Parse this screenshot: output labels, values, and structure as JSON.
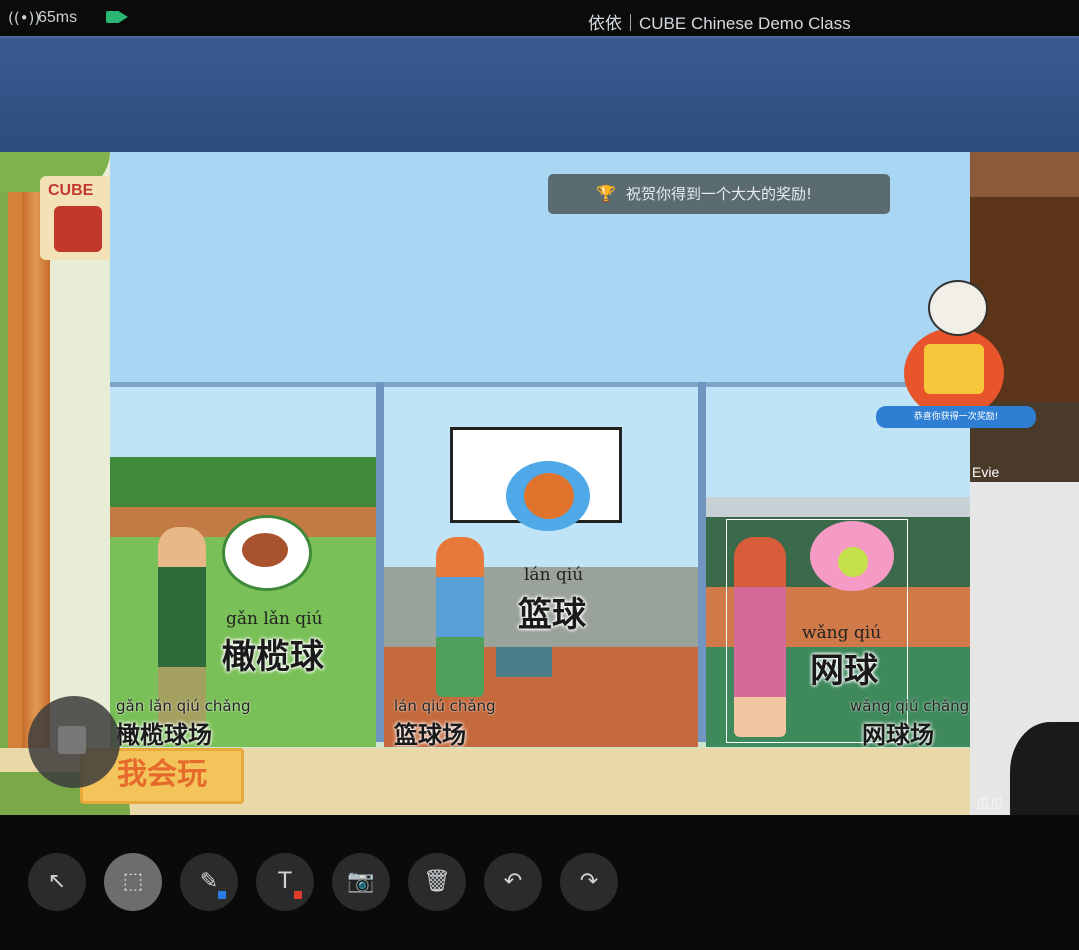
{
  "status": {
    "latency": "65ms",
    "window_title": "依依｜CUBE Chinese Demo Class"
  },
  "notice": {
    "text": "祝贺你得到一个大大的奖励!"
  },
  "logo": {
    "text": "CUBE"
  },
  "slide": {
    "football": {
      "pinyin": "gǎn lǎn qiú",
      "hanzi": "橄榄球",
      "field_pinyin": "gǎn lǎn qiú chǎng",
      "field_hanzi": "橄榄球场"
    },
    "basketball": {
      "pinyin": "lán qiú",
      "hanzi": "篮球",
      "field_pinyin": "lán qiú chǎng",
      "field_hanzi": "篮球场"
    },
    "tennis": {
      "pinyin": "wǎng qiú",
      "hanzi": "网球",
      "field_pinyin": "wǎng qiú chǎng",
      "field_hanzi": "网球场"
    },
    "sign": "我会玩"
  },
  "participants": [
    {
      "name": "Evie"
    },
    {
      "name": "瓜瓜"
    }
  ],
  "reward_badge": {
    "text": "恭喜你获得一次奖励!"
  },
  "toolbar": {
    "tools": [
      "pointer",
      "select",
      "pen",
      "text",
      "screenshot",
      "delete",
      "undo",
      "redo"
    ],
    "icons": {
      "pointer": "↖",
      "select": "⬚",
      "pen": "✎",
      "text": "T",
      "screenshot": "📷",
      "delete": "🗑",
      "undo": "↶",
      "redo": "↷"
    },
    "active": "select"
  },
  "colors": {
    "accent_red": "#e03a2a",
    "accent_blue": "#2b7de0",
    "toast_bg": "#5a6b72"
  }
}
